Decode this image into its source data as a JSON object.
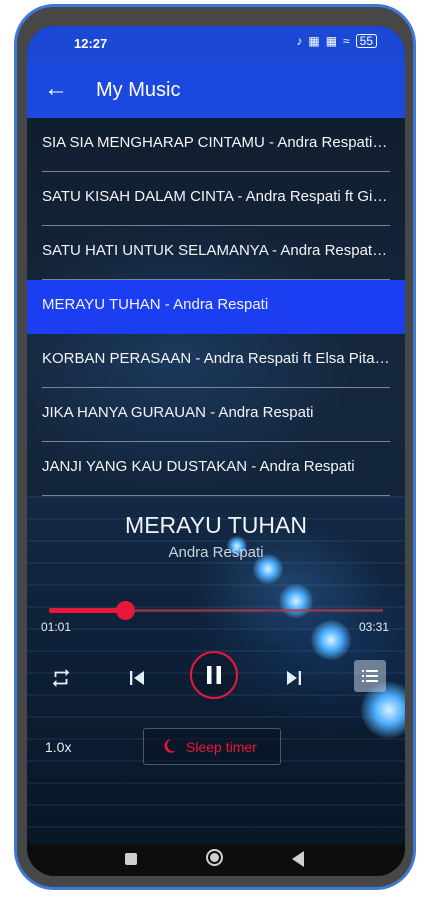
{
  "status_bar": {
    "time": "12:27",
    "battery": "55"
  },
  "app_bar": {
    "title": "My Music"
  },
  "songs": [
    {
      "label": "SIA SIA MENGHARAP CINTAMU - Andra Respati ft Gita KDI"
    },
    {
      "label": "SATU KISAH DALAM CINTA - Andra Respati ft Gita KDI"
    },
    {
      "label": "SATU HATI UNTUK SELAMANYA - Andra Respati ft Elsa Pitaloka"
    },
    {
      "label": "MERAYU TUHAN - Andra Respati",
      "active": true
    },
    {
      "label": "KORBAN PERASAAN - Andra Respati ft Elsa Pitaloka"
    },
    {
      "label": "JIKA HANYA GURAUAN - Andra Respati"
    },
    {
      "label": "JANJI YANG KAU DUSTAKAN - Andra Respati"
    }
  ],
  "now_playing": {
    "title": "MERAYU TUHAN",
    "artist": "Andra Respati",
    "elapsed": "01:01",
    "duration": "03:31",
    "progress": 0.23
  },
  "controls": {
    "speed": "1.0x",
    "sleep_timer_label": "Sleep timer",
    "icons": [
      "repeat-icon",
      "previous-icon",
      "pause-icon",
      "next-icon",
      "queue-list-icon",
      "moon-icon"
    ]
  },
  "colors": {
    "app_bar": "#1b49e0",
    "active_item": "#1c3ef2",
    "accent": "#e8183a"
  }
}
